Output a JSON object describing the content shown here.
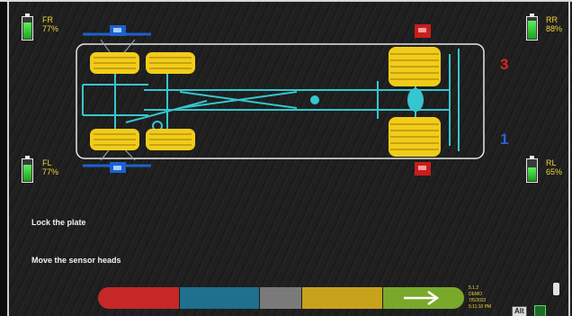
{
  "sensors": {
    "fr": {
      "label": "FR",
      "charge": "77%",
      "level": 0.77
    },
    "fl": {
      "label": "FL",
      "charge": "77%",
      "level": 0.77
    },
    "rr": {
      "label": "RR",
      "charge": "88%",
      "level": 0.88
    },
    "rl": {
      "label": "RL",
      "charge": "65%",
      "level": 0.65
    }
  },
  "markers": {
    "top": "3",
    "bottom": "1"
  },
  "instructions": {
    "line1": "Lock the plate",
    "line2": "Move the sensor heads"
  },
  "progress": {
    "segments": [
      {
        "name": "red",
        "color": "#c62828"
      },
      {
        "name": "blue",
        "color": "#1f6f8f"
      },
      {
        "name": "gray",
        "color": "#7a7a7a"
      },
      {
        "name": "yellow",
        "color": "#c9a21c"
      },
      {
        "name": "green",
        "color": "#7aa82a"
      }
    ]
  },
  "info": {
    "version": "5.1.2",
    "code": "DEMO",
    "date": "7/5/2022",
    "time": "5:11:10 PM"
  },
  "status": {
    "alt_label": "Alt"
  },
  "colors": {
    "vehicle": "#35c6cf",
    "wheel": "#f2cc1a",
    "sensor_front": "#1f5fd0",
    "sensor_rear": "#c81e1e",
    "marker_top": "#e02424",
    "marker_bottom": "#2b63d6"
  }
}
